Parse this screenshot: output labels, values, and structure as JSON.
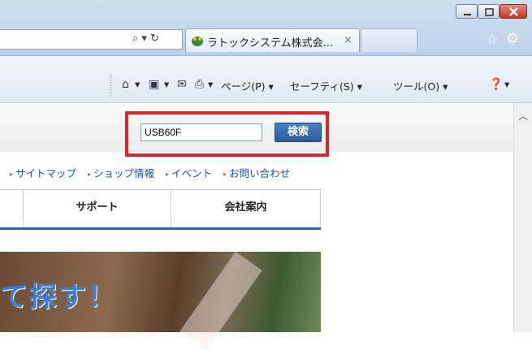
{
  "browser": {
    "tab_title": "ラトックシステム株式会...",
    "tab_close": "×",
    "address_search_symbol": "⌕ ▾ ↻",
    "favorites_icon": "star-icon",
    "tools_icon": "gear-icon"
  },
  "commandbar": {
    "home_arrow": "▾",
    "feeds_arrow": "▾",
    "print_arrow": "▾",
    "page_menu": "ページ(P) ▾",
    "safety_menu": "セーフティ(S) ▾",
    "tools_menu": "ツール(O) ▾",
    "help_arrow": "▾"
  },
  "search": {
    "value": "USB60F",
    "button_label": "検索"
  },
  "links": [
    "サイトマップ",
    "ショップ情報",
    "イベント",
    "お問い合わせ"
  ],
  "nav": {
    "support": "サポート",
    "company": "会社案内"
  },
  "banner": {
    "text": "て探す！"
  },
  "colors": {
    "highlight": "#e0232b",
    "search_button": "#2a5a98",
    "link": "#1a4f9c",
    "banner_text": "#3d7fd6"
  }
}
